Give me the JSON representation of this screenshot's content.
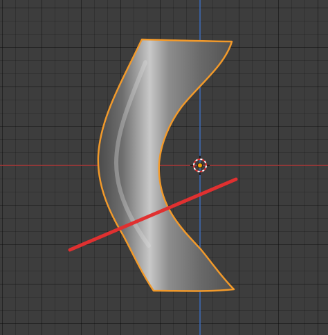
{
  "viewport": {
    "grid": "on",
    "colors": {
      "background": "#3d3d3d",
      "x_axis": "#b13c3c",
      "y_axis": "#3e6fbf",
      "selection_outline": "#f29a2b",
      "mesh_mid": "#8a8a8a",
      "cursor_red": "#e03030",
      "origin_dot": "#f0a000"
    },
    "selected_object": {
      "shape": "curved-ribbon",
      "selected": true
    },
    "annotation": {
      "type": "red-line"
    },
    "icons": {
      "origin": "origin-dot-icon",
      "cursor": "3d-cursor-icon"
    }
  }
}
